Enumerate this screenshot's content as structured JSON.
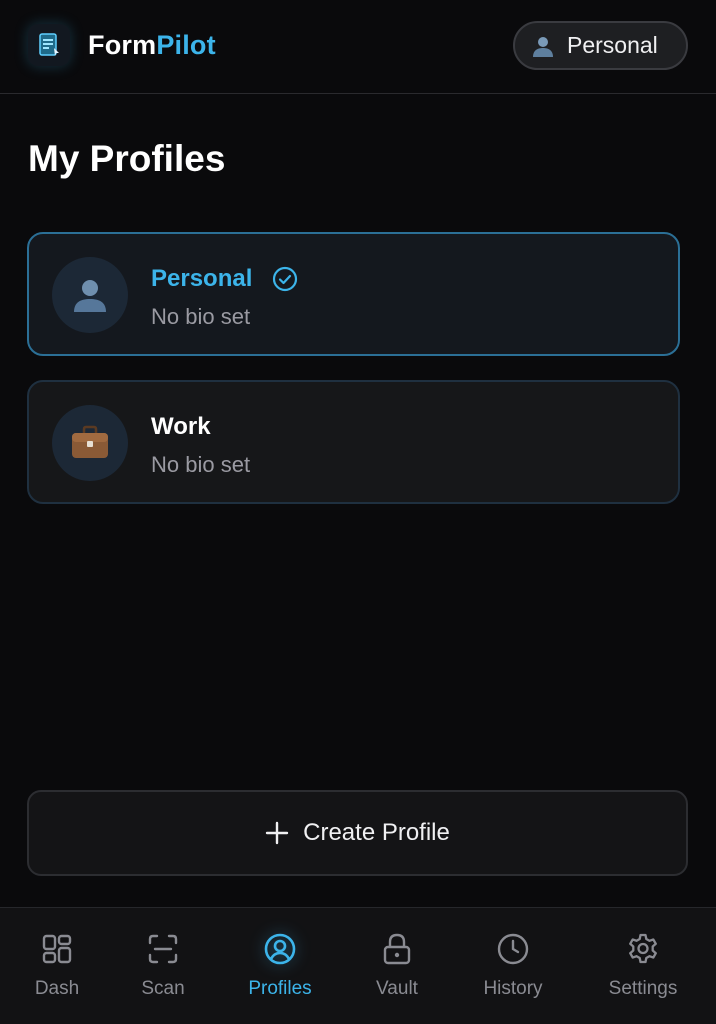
{
  "header": {
    "brand_part1": "Form",
    "brand_part2": "Pilot",
    "logo_icon": "document-sparkle-icon",
    "current_profile": "Personal",
    "current_profile_icon": "person-icon"
  },
  "page": {
    "title": "My Profiles"
  },
  "profiles": [
    {
      "name": "Personal",
      "bio": "No bio set",
      "icon": "person-icon",
      "active": true,
      "status_icon": "check-circle-icon"
    },
    {
      "name": "Work",
      "bio": "No bio set",
      "icon": "briefcase-icon",
      "active": false
    }
  ],
  "actions": {
    "create_label": "Create Profile",
    "create_icon": "plus-icon"
  },
  "nav": {
    "items": [
      {
        "label": "Dash",
        "icon": "grid-icon",
        "active": false
      },
      {
        "label": "Scan",
        "icon": "scan-icon",
        "active": false
      },
      {
        "label": "Profiles",
        "icon": "user-circle-icon",
        "active": true
      },
      {
        "label": "Vault",
        "icon": "lock-icon",
        "active": false
      },
      {
        "label": "History",
        "icon": "clock-icon",
        "active": false
      },
      {
        "label": "Settings",
        "icon": "gear-icon",
        "active": false
      }
    ]
  },
  "colors": {
    "accent": "#3cb4ea",
    "background": "#0a0a0c",
    "card": "#161719",
    "muted_text": "#9a9aa2"
  }
}
